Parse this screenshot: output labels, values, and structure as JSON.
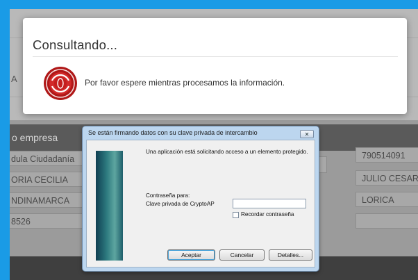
{
  "loading": {
    "title": "Consultando...",
    "message": "Por favor espere mientras procesamos la información."
  },
  "background": {
    "side_letter": "A",
    "section_title": "o empresa",
    "left_fields": [
      "dula Ciudadanía",
      "ORIA CECILIA",
      "NDINAMARCA",
      "8526"
    ],
    "right_fields": [
      "790514091",
      "JULIO CESAR",
      "LORICA",
      ""
    ]
  },
  "dialog": {
    "title": "Se están firmando datos con su clave privada de intercambio",
    "close_label": "✕",
    "request_text": "Una aplicación está solicitando acceso a un elemento protegido.",
    "password_for": "Contraseña para:",
    "key_name": "Clave privada de CryptoAP",
    "password_value": "",
    "remember_label": "Recordar contraseña",
    "remember_checked": false,
    "ok_label": "Aceptar",
    "cancel_label": "Cancelar",
    "details_label": "Detalles..."
  },
  "colors": {
    "accent_border": "#1a9be6",
    "spinner_red": "#c41e1e"
  }
}
